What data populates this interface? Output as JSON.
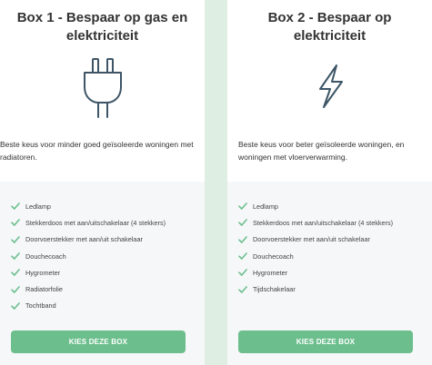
{
  "boxes": [
    {
      "title": "Box 1 - Bespaar op gas en elektriciteit",
      "icon": "plug-icon",
      "description": "Beste keus voor minder goed geïsoleerde woningen met radiatoren.",
      "features": [
        "Ledlamp",
        "Stekkerdoos met aan/uitschakelaar (4 stekkers)",
        "Doorvoerstekker met aan/uit schakelaar",
        "Douchecoach",
        "Hygrometer",
        "Radiatorfolie",
        "Tochtband"
      ],
      "button_label": "KIES DEZE BOX"
    },
    {
      "title": "Box 2 - Bespaar op elektriciteit",
      "icon": "lightning-icon",
      "description": "Beste keus voor beter geïsoleerde woningen, en woningen met vloerverwarming.",
      "features": [
        "Ledlamp",
        "Stekkerdoos met aan/uitschakelaar (4 stekkers)",
        "Doorvoerstekker met aan/uit schakelaar",
        "Douchecoach",
        "Hygrometer",
        "Tijdschakelaar"
      ],
      "button_label": "KIES DEZE BOX"
    }
  ],
  "colors": {
    "page_background": "#dfeee3",
    "card_background": "#ffffff",
    "features_background": "#f5f7f9",
    "accent": "#6cbf8d",
    "icon_stroke": "#3d5566"
  }
}
